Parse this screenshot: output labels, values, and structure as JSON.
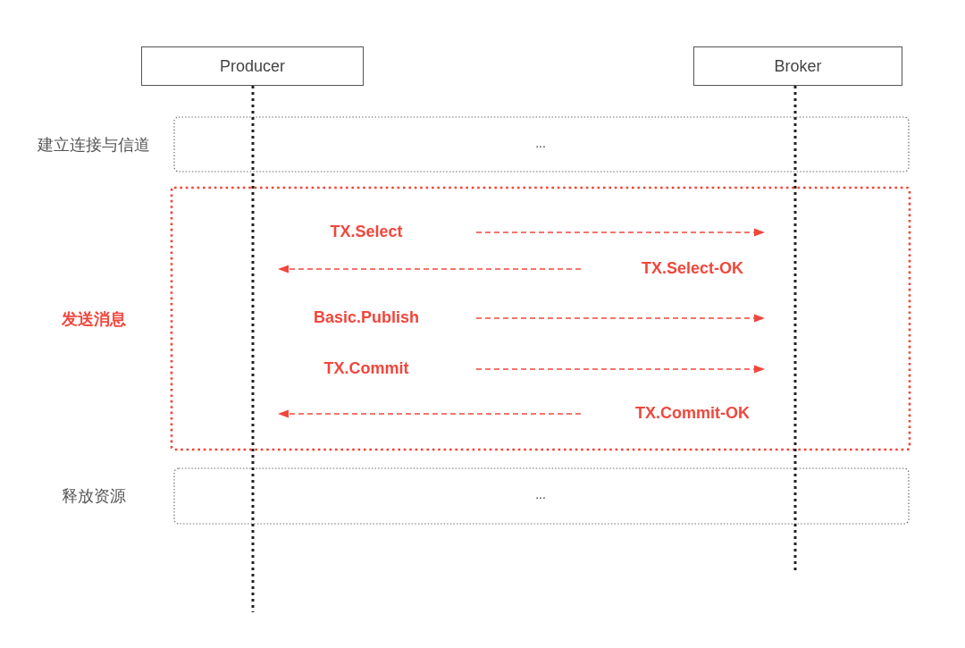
{
  "participants": [
    {
      "name": "Producer"
    },
    {
      "name": "Broker"
    }
  ],
  "sections": [
    {
      "label": "建立连接与信道",
      "highlighted": false,
      "content": "..."
    },
    {
      "label": "发送消息",
      "highlighted": true,
      "messages": [
        {
          "label": "TX.Select",
          "kind": "request"
        },
        {
          "label": "TX.Select-OK",
          "kind": "reply"
        },
        {
          "label": "Basic.Publish",
          "kind": "request"
        },
        {
          "label": "TX.Commit",
          "kind": "request"
        },
        {
          "label": "TX.Commit-OK",
          "kind": "reply"
        }
      ]
    },
    {
      "label": "释放资源",
      "highlighted": false,
      "content": "..."
    }
  ]
}
